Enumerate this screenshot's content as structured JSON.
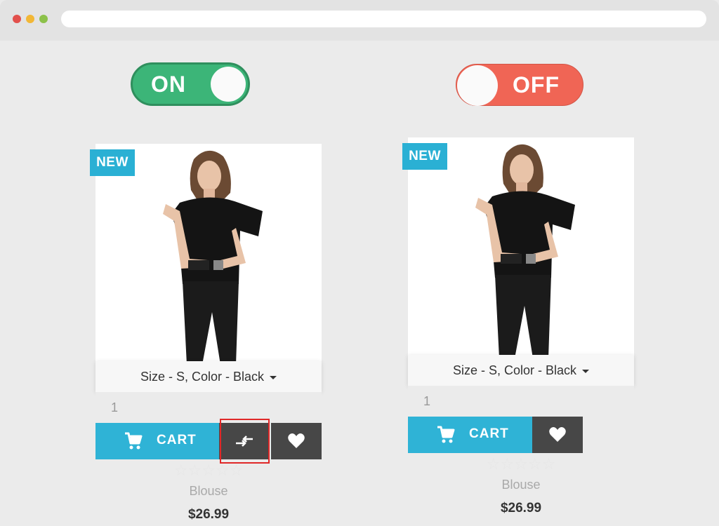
{
  "toggles": {
    "on_label": "ON",
    "off_label": "OFF",
    "on_color": "#3cb578",
    "off_color": "#f06555"
  },
  "cards": [
    {
      "badge": "NEW",
      "variant": "Size - S, Color - Black",
      "quantity": "1",
      "cart_label": "CART",
      "rating": "☆☆☆☆☆",
      "name": "Blouse",
      "price": "$26.99",
      "show_compare": true
    },
    {
      "badge": "NEW",
      "variant": "Size - S, Color - Black",
      "quantity": "1",
      "cart_label": "CART",
      "rating": "☆☆☆☆☆",
      "name": "Blouse",
      "price": "$26.99",
      "show_compare": false
    }
  ],
  "icons": {
    "cart": "cart-icon",
    "compare": "compare-arrows-icon",
    "wishlist": "heart-icon"
  },
  "colors": {
    "accent": "#2fb3d6",
    "dark_button": "#474747",
    "highlight": "#e02828"
  }
}
